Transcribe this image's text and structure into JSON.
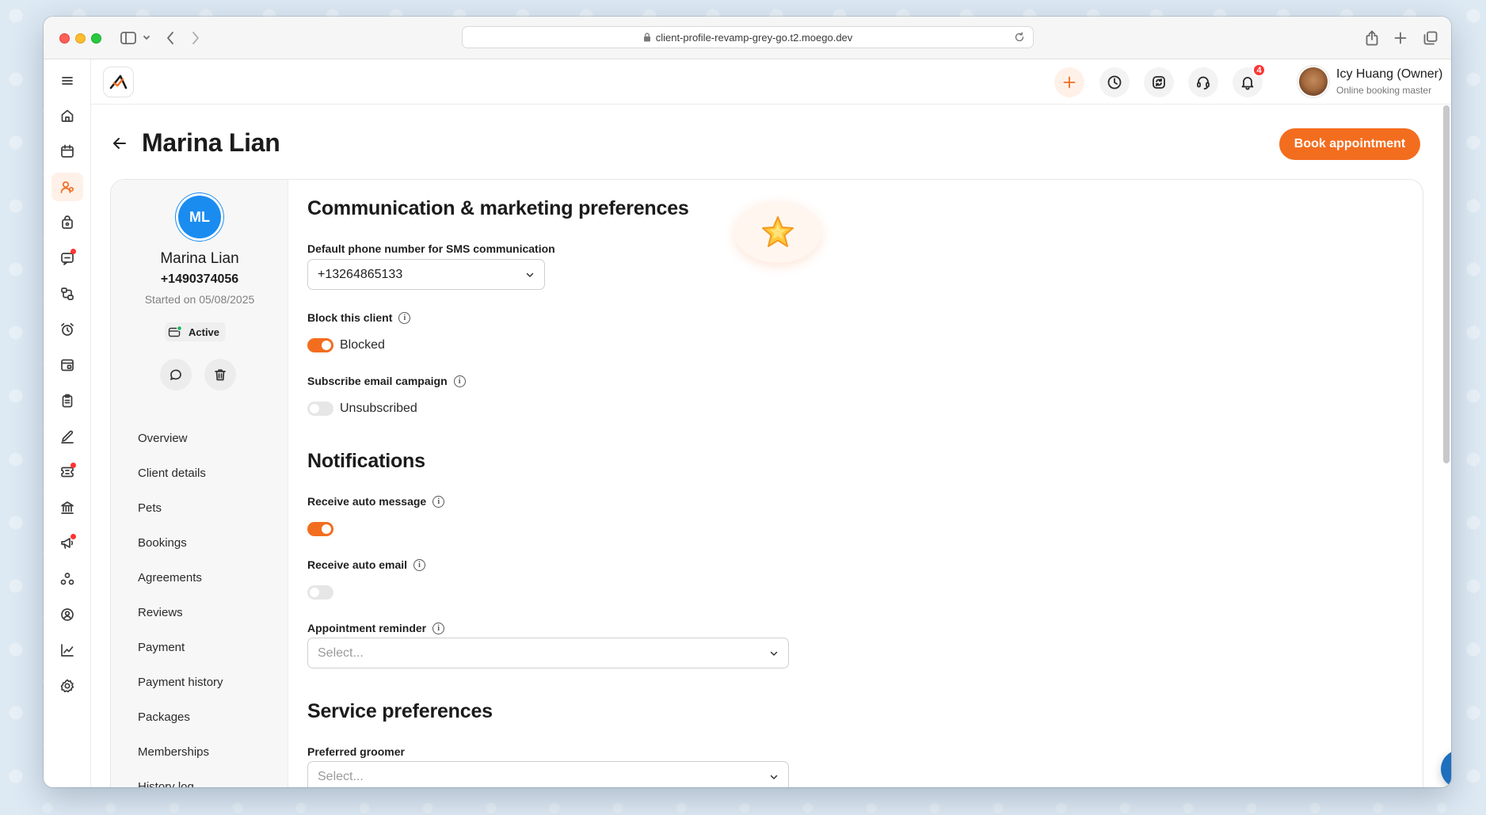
{
  "browser": {
    "url": "client-profile-revamp-grey-go.t2.moego.dev"
  },
  "topbar": {
    "notification_count": "4",
    "user_name": "Icy Huang (Owner)",
    "user_role": "Online booking master"
  },
  "page": {
    "title": "Marina Lian",
    "book_button": "Book appointment"
  },
  "profile": {
    "initials": "ML",
    "name": "Marina Lian",
    "phone": "+1490374056",
    "since": "Started on 05/08/2025",
    "status": "Active"
  },
  "nav": {
    "items": [
      {
        "label": "Overview"
      },
      {
        "label": "Client details"
      },
      {
        "label": "Pets"
      },
      {
        "label": "Bookings"
      },
      {
        "label": "Agreements"
      },
      {
        "label": "Reviews"
      },
      {
        "label": "Payment"
      },
      {
        "label": "Payment history"
      },
      {
        "label": "Packages"
      },
      {
        "label": "Memberships"
      },
      {
        "label": "History log"
      }
    ]
  },
  "communication": {
    "title": "Communication & marketing preferences",
    "sms_label": "Default phone number for SMS communication",
    "sms_value": "+13264865133",
    "block_label": "Block this client",
    "block_state": "Blocked",
    "block_on": true,
    "email_campaign_label": "Subscribe email campaign",
    "email_campaign_state": "Unsubscribed",
    "email_campaign_on": false
  },
  "notifications": {
    "title": "Notifications",
    "auto_message_label": "Receive auto message",
    "auto_message_on": true,
    "auto_email_label": "Receive auto email",
    "auto_email_on": false,
    "reminder_label": "Appointment reminder",
    "reminder_placeholder": "Select..."
  },
  "service": {
    "title": "Service preferences",
    "groomer_label": "Preferred groomer",
    "groomer_placeholder": "Select..."
  },
  "colors": {
    "accent": "#f36d1f",
    "avatar_blue": "#1a8cf0",
    "fab_blue": "#1f6fbf"
  }
}
